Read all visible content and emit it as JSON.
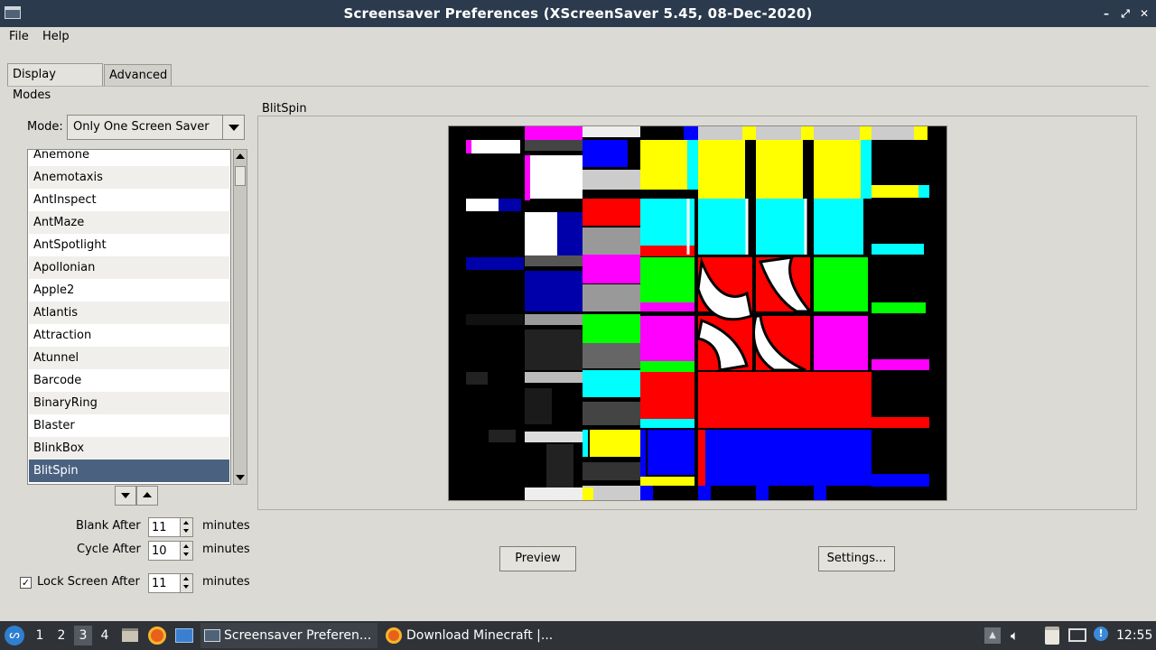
{
  "window": {
    "title": "Screensaver Preferences  (XScreenSaver 5.45, 08-Dec-2020)",
    "controls": [
      "minimize-icon",
      "maximize-icon",
      "close-icon"
    ]
  },
  "menubar": {
    "file": "File",
    "help": "Help"
  },
  "tabs": [
    {
      "label": "Display Modes",
      "active": true
    },
    {
      "label": "Advanced",
      "active": false
    }
  ],
  "mode": {
    "label": "Mode:",
    "value": "Only One Screen Saver"
  },
  "screensavers": [
    "Anemone",
    "Anemotaxis",
    "AntInspect",
    "AntMaze",
    "AntSpotlight",
    "Apollonian",
    "Apple2",
    "Atlantis",
    "Attraction",
    "Atunnel",
    "Barcode",
    "BinaryRing",
    "Blaster",
    "BlinkBox",
    "BlitSpin"
  ],
  "selected_screensaver": "BlitSpin",
  "settings": {
    "blank_after": {
      "label": "Blank After",
      "value": "11",
      "unit": "minutes"
    },
    "cycle_after": {
      "label": "Cycle After",
      "value": "10",
      "unit": "minutes"
    },
    "lock_screen_after": {
      "label": "Lock Screen After",
      "value": "11",
      "unit": "minutes",
      "checked": true
    }
  },
  "preview": {
    "frame_label": "BlitSpin",
    "preview_button": "Preview",
    "settings_button": "Settings..."
  },
  "colors": {
    "titlebar": "#2b3a4c",
    "selection": "#4b6180",
    "taskbar": "#2f3338",
    "window_bg": "#dcdad5"
  },
  "taskbar": {
    "workspaces": [
      "1",
      "2",
      "3",
      "4"
    ],
    "active_workspace": "3",
    "launchers": [
      "files-icon",
      "firefox-icon",
      "terminal-icon"
    ],
    "tasks": [
      {
        "label": "Screensaver Preferen...",
        "icon": "window-icon",
        "active": true
      },
      {
        "label": "Download Minecraft |...",
        "icon": "firefox-icon",
        "active": false
      }
    ],
    "tray": [
      "eject-icon",
      "volume-icon",
      "clipboard-icon",
      "network-icon",
      "update-icon"
    ],
    "clock": "12:55"
  }
}
